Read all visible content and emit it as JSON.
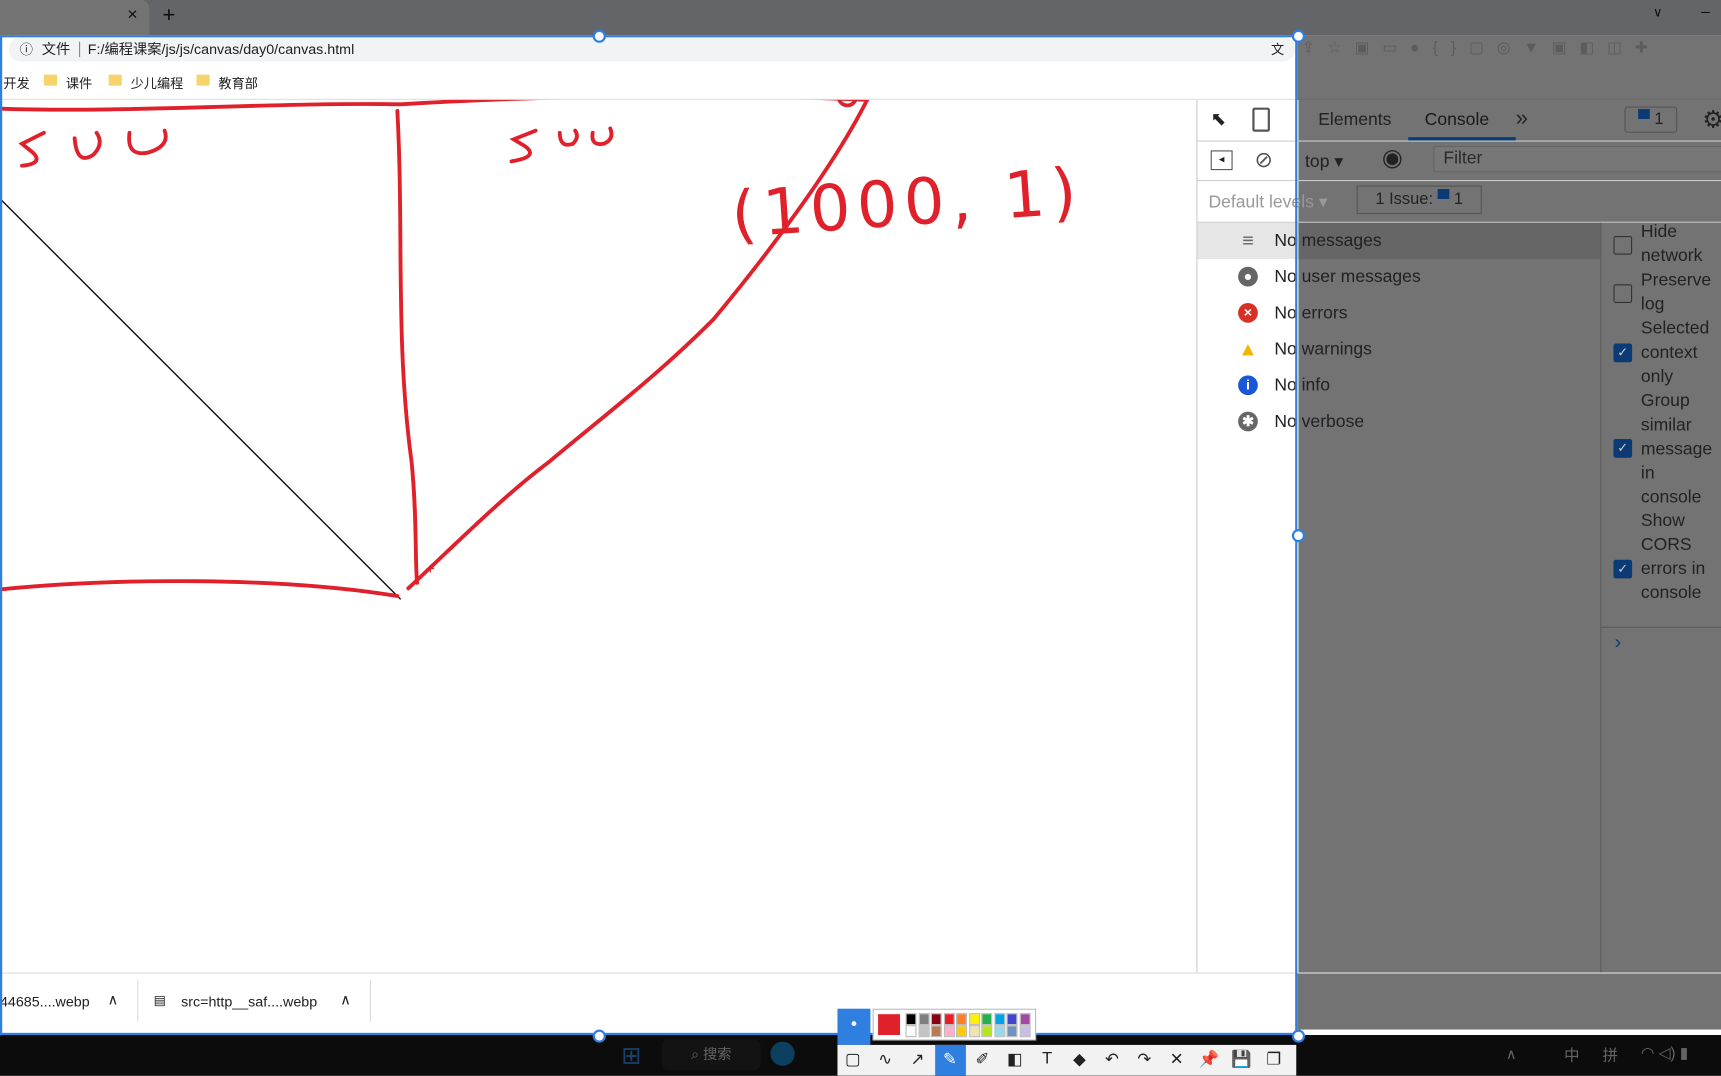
{
  "browser": {
    "tab_close": "×",
    "new_tab": "+",
    "window_minimize": "–",
    "window_chevron": "∨",
    "address_prefix": "文件",
    "url": "F:/编程课案/js/js/canvas/day0/canvas.html",
    "bookmarks": [
      {
        "label": "开发"
      },
      {
        "label": "课件"
      },
      {
        "label": "少儿编程"
      },
      {
        "label": "教育部"
      }
    ]
  },
  "canvas_annotations": {
    "label_left": "500",
    "label_right": "500",
    "point": "(1000, 1)",
    "stroke_color": "#e0202a"
  },
  "devtools": {
    "tabs": [
      {
        "label": "Elements"
      },
      {
        "label": "Console",
        "active": true
      }
    ],
    "more": "»",
    "issues_badge": "1",
    "context": "top",
    "filter_placeholder": "Filter",
    "levels": "Default levels",
    "issues_label": "1 Issue:",
    "issues_count": "1",
    "messages": [
      {
        "label": "No messages",
        "icon": "list-icon"
      },
      {
        "label": "No user messages",
        "icon": "user-icon"
      },
      {
        "label": "No errors",
        "icon": "error-icon",
        "color": "#d93025"
      },
      {
        "label": "No warnings",
        "icon": "warning-icon",
        "color": "#f2b600"
      },
      {
        "label": "No info",
        "icon": "info-icon",
        "color": "#1a57d6"
      },
      {
        "label": "No verbose",
        "icon": "bug-icon"
      }
    ],
    "settings": [
      {
        "label": "Hide network",
        "checked": false
      },
      {
        "label": "Preserve log",
        "checked": false
      },
      {
        "label": "Selected context only",
        "checked": true
      },
      {
        "label": "Group similar message in console",
        "checked": true
      },
      {
        "label": "Show CORS errors in console",
        "checked": true
      }
    ],
    "prompt": "›"
  },
  "downloads": [
    {
      "label": "44685....webp"
    },
    {
      "label": "src=http__saf....webp"
    }
  ],
  "taskbar": {
    "search": "搜索",
    "tray": [
      "∧",
      "中",
      "拼"
    ]
  },
  "snip_tools": [
    "▢",
    "∿",
    "↗",
    "✎",
    "✐",
    "◧",
    "T",
    "◆",
    "↶",
    "↷",
    "✕",
    "📌",
    "💾",
    "❐"
  ]
}
